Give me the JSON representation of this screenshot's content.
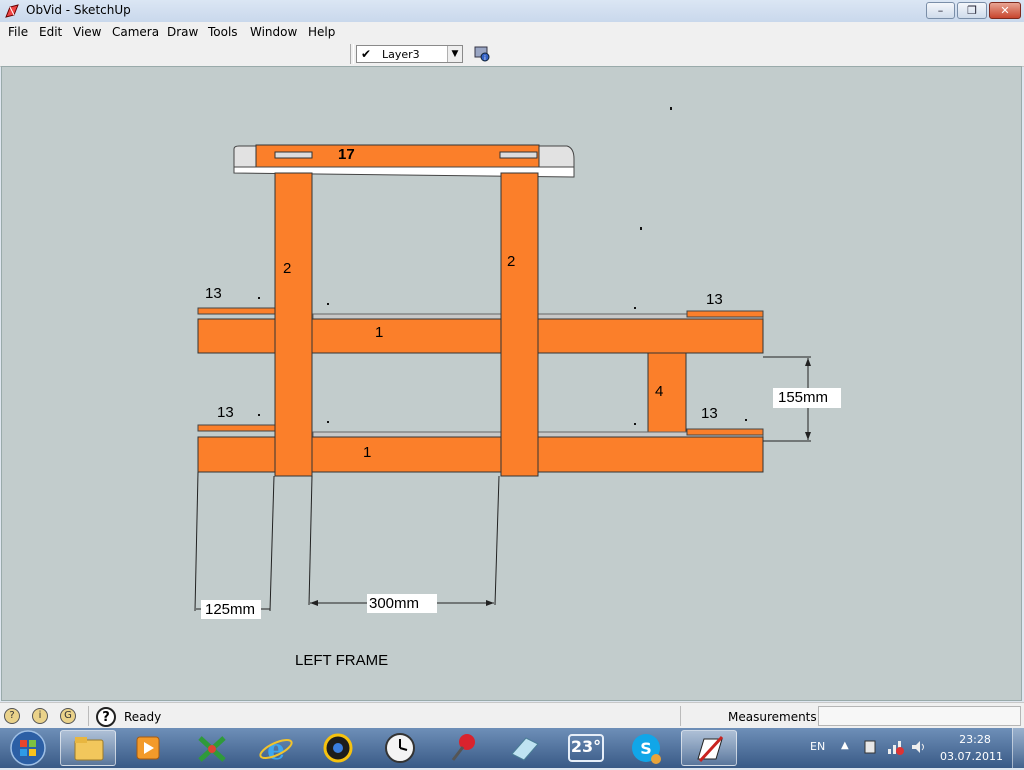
{
  "window": {
    "title": "ObVid - SketchUp",
    "controls": {
      "minimize": "–",
      "maximize": "❐",
      "close": "✕"
    }
  },
  "menu": {
    "items": [
      "File",
      "Edit",
      "View",
      "Camera",
      "Draw",
      "Tools",
      "Window",
      "Help"
    ]
  },
  "toolbar": {
    "layer": {
      "check": "✔",
      "selected": "Layer3"
    }
  },
  "drawing": {
    "top_beam_label": "17",
    "post_labels": [
      "2",
      "2"
    ],
    "rail_labels": [
      "1",
      "1"
    ],
    "spacer_label": "4",
    "cap_labels": [
      "13",
      "13",
      "13",
      "13"
    ],
    "dimensions": {
      "left": "125mm",
      "middle": "300mm",
      "vertical": "155mm"
    },
    "caption": "LEFT FRAME"
  },
  "status": {
    "text": "Ready",
    "measurements_label": "Measurements",
    "measurements_value": "",
    "icons": [
      "geo-location-icon",
      "credits-icon",
      "google-signin-icon"
    ]
  },
  "taskbar": {
    "apps": [
      {
        "name": "explorer",
        "icon": "folder-icon"
      },
      {
        "name": "media-player",
        "icon": "play-icon"
      },
      {
        "name": "xmind",
        "icon": "x-icon"
      },
      {
        "name": "internet-explorer",
        "icon": "ie-icon"
      },
      {
        "name": "settings",
        "icon": "gear-icon"
      },
      {
        "name": "clock",
        "icon": "clock-icon"
      },
      {
        "name": "pin",
        "icon": "pushpin-icon"
      },
      {
        "name": "notes",
        "icon": "note-icon"
      },
      {
        "name": "weather",
        "icon": "weather-icon",
        "text": "23°"
      },
      {
        "name": "skype",
        "icon": "skype-icon"
      },
      {
        "name": "sketchup",
        "icon": "sketchup-icon",
        "active": true
      }
    ],
    "language": "EN",
    "time": "23:28",
    "date": "03.07.2011"
  },
  "colors": {
    "beam": "#fb7f2a",
    "canvas": "#c2cccc",
    "cap_gray": "#c8c8c8"
  }
}
